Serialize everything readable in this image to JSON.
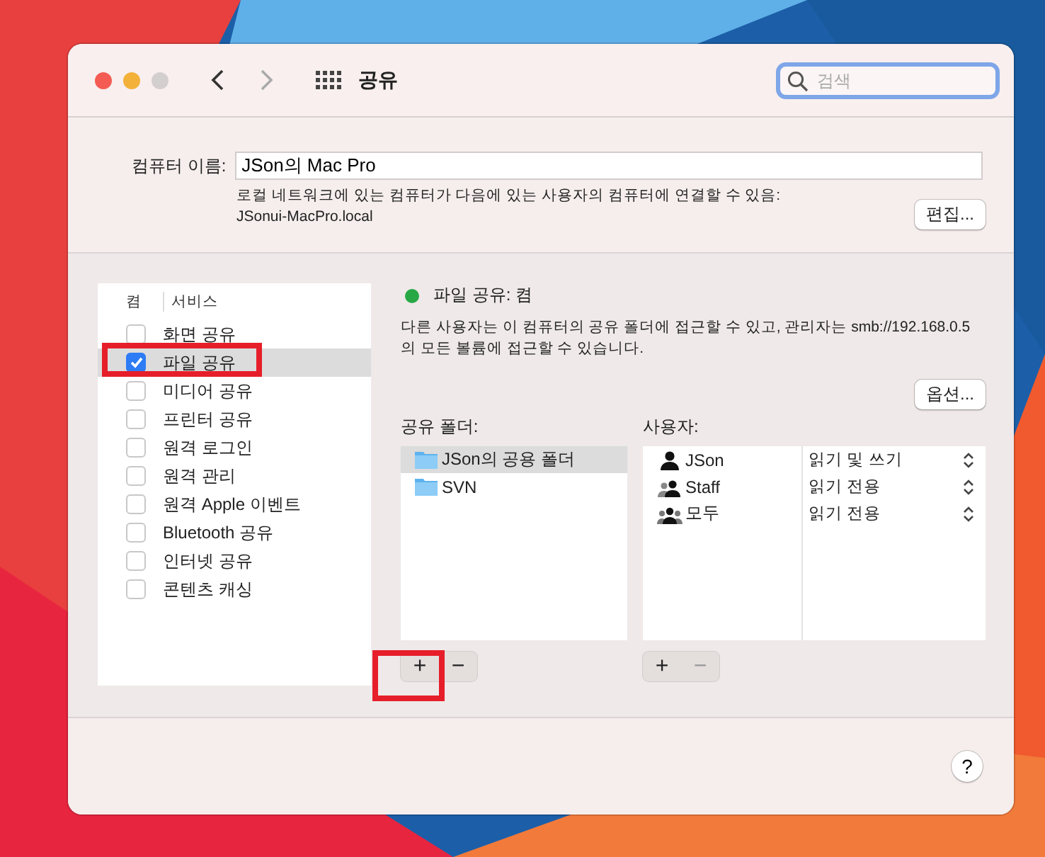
{
  "window": {
    "title": "공유",
    "search": {
      "placeholder": "검색"
    }
  },
  "computer_name": {
    "label": "컴퓨터 이름:",
    "value": "JSon의 Mac Pro",
    "description": "로컬 네트워크에 있는 컴퓨터가 다음에 있는 사용자의 컴퓨터에 연결할 수 있음:",
    "address": "JSonui-MacPro.local",
    "edit_button": "편집..."
  },
  "services": {
    "columns": [
      "켬",
      "서비스"
    ],
    "items": [
      {
        "name": "화면 공유",
        "checked": false,
        "selected": false,
        "highlighted": false
      },
      {
        "name": "파일 공유",
        "checked": true,
        "selected": true,
        "highlighted": true
      },
      {
        "name": "미디어 공유",
        "checked": false,
        "selected": false,
        "highlighted": false
      },
      {
        "name": "프린터 공유",
        "checked": false,
        "selected": false,
        "highlighted": false
      },
      {
        "name": "원격 로그인",
        "checked": false,
        "selected": false,
        "highlighted": false
      },
      {
        "name": "원격 관리",
        "checked": false,
        "selected": false,
        "highlighted": false
      },
      {
        "name": "원격 Apple 이벤트",
        "checked": false,
        "selected": false,
        "highlighted": false
      },
      {
        "name": "Bluetooth 공유",
        "checked": false,
        "selected": false,
        "highlighted": false
      },
      {
        "name": "인터넷 공유",
        "checked": false,
        "selected": false,
        "highlighted": false
      },
      {
        "name": "콘텐츠 캐싱",
        "checked": false,
        "selected": false,
        "highlighted": false
      }
    ]
  },
  "status": {
    "on": true,
    "text": "파일 공유: 켬",
    "description": "다른 사용자는 이 컴퓨터의 공유 폴더에 접근할 수 있고, 관리자는 smb://192.168.0.5의 모든 볼륨에 접근할 수 있습니다.",
    "options_button": "옵션..."
  },
  "shared_folders": {
    "label": "공유 폴더:",
    "items": [
      {
        "name": "JSon의 공용 폴더",
        "selected": true
      },
      {
        "name": "SVN",
        "selected": false
      }
    ],
    "buttons": [
      {
        "label": "+",
        "disabled": false,
        "highlighted": true
      },
      {
        "label": "−",
        "disabled": false,
        "highlighted": false
      }
    ]
  },
  "users": {
    "label": "사용자:",
    "items": [
      {
        "name": "JSon",
        "kind": "user",
        "permission": "읽기 및 쓰기"
      },
      {
        "name": "Staff",
        "kind": "group",
        "permission": "읽기 전용"
      },
      {
        "name": "모두",
        "kind": "everyone",
        "permission": "읽기 전용"
      }
    ],
    "buttons": [
      {
        "label": "+",
        "disabled": false,
        "highlighted": false
      },
      {
        "label": "−",
        "disabled": true,
        "highlighted": false
      }
    ]
  },
  "help_button": "?"
}
